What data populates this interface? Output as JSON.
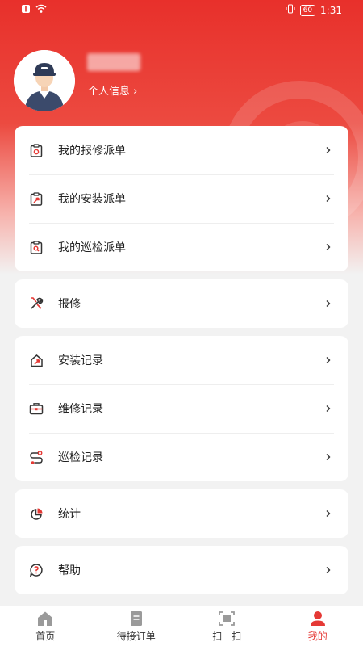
{
  "status_bar": {
    "time": "1:31",
    "battery": "60"
  },
  "profile": {
    "link_label": "个人信息 ›"
  },
  "groups": [
    {
      "items": [
        {
          "label": "我的报修派单",
          "icon": "clipboard-repair-icon"
        },
        {
          "label": "我的安装派单",
          "icon": "clipboard-wrench-icon"
        },
        {
          "label": "我的巡检派单",
          "icon": "clipboard-search-icon"
        }
      ]
    },
    {
      "items": [
        {
          "label": "报修",
          "icon": "tools-icon"
        }
      ]
    },
    {
      "items": [
        {
          "label": "安装记录",
          "icon": "home-wrench-icon"
        },
        {
          "label": "维修记录",
          "icon": "toolbox-icon"
        },
        {
          "label": "巡检记录",
          "icon": "route-icon"
        }
      ]
    },
    {
      "items": [
        {
          "label": "统计",
          "icon": "pie-chart-icon"
        }
      ]
    },
    {
      "items": [
        {
          "label": "帮助",
          "icon": "help-icon"
        }
      ]
    }
  ],
  "tabs": [
    {
      "label": "首页",
      "icon": "home-icon"
    },
    {
      "label": "待接订单",
      "icon": "document-icon"
    },
    {
      "label": "扫一扫",
      "icon": "scan-icon"
    },
    {
      "label": "我的",
      "icon": "user-icon",
      "active": true
    }
  ],
  "colors": {
    "accent": "#e53935",
    "header": "#e8302b",
    "icon_dark": "#333333"
  }
}
